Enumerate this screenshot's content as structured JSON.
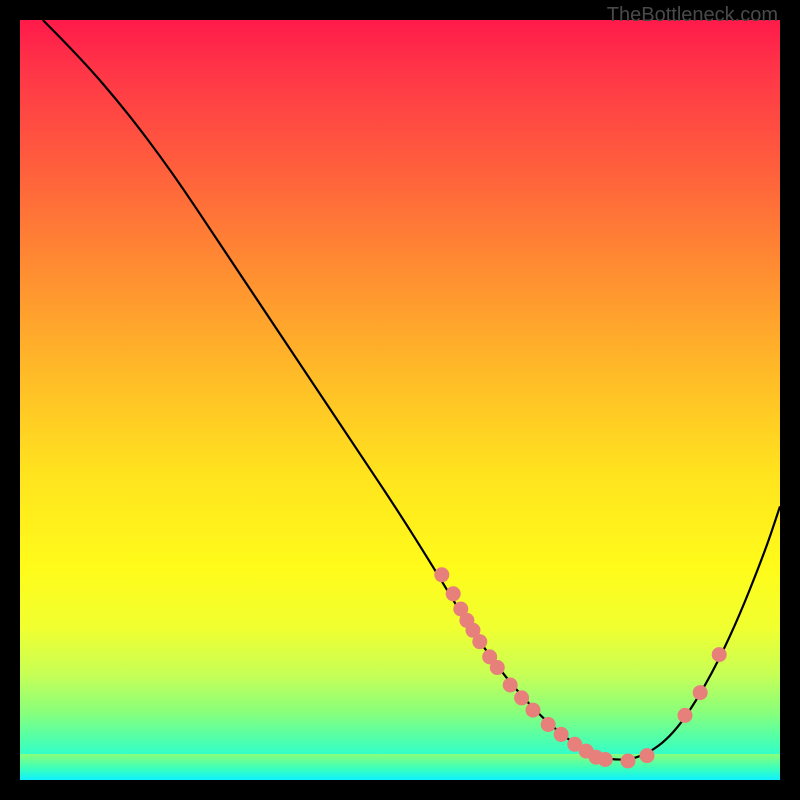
{
  "watermark": "TheBottleneck.com",
  "chart_data": {
    "type": "line",
    "title": "",
    "xlabel": "",
    "ylabel": "",
    "xlim": [
      0,
      100
    ],
    "ylim": [
      0,
      100
    ],
    "series": [
      {
        "name": "curve",
        "x": [
          3,
          8,
          14,
          20,
          26,
          32,
          38,
          44,
          50,
          55,
          58,
          62,
          66,
          70,
          74,
          78,
          82,
          86,
          90,
          94,
          98,
          100
        ],
        "y": [
          100,
          95,
          88,
          80,
          71,
          62,
          53,
          44,
          35,
          27,
          22,
          16,
          11,
          7,
          4,
          2.5,
          3,
          6,
          12,
          20,
          30,
          36
        ]
      }
    ],
    "markers": [
      {
        "x": 55.5,
        "y": 27.0
      },
      {
        "x": 57.0,
        "y": 24.5
      },
      {
        "x": 58.0,
        "y": 22.5
      },
      {
        "x": 58.8,
        "y": 21.0
      },
      {
        "x": 59.6,
        "y": 19.7
      },
      {
        "x": 60.5,
        "y": 18.2
      },
      {
        "x": 61.8,
        "y": 16.2
      },
      {
        "x": 62.8,
        "y": 14.8
      },
      {
        "x": 64.5,
        "y": 12.5
      },
      {
        "x": 66.0,
        "y": 10.8
      },
      {
        "x": 67.5,
        "y": 9.2
      },
      {
        "x": 69.5,
        "y": 7.3
      },
      {
        "x": 71.2,
        "y": 6.0
      },
      {
        "x": 73.0,
        "y": 4.7
      },
      {
        "x": 74.5,
        "y": 3.8
      },
      {
        "x": 75.8,
        "y": 3.0
      },
      {
        "x": 77.0,
        "y": 2.7
      },
      {
        "x": 80.0,
        "y": 2.5
      },
      {
        "x": 82.5,
        "y": 3.2
      },
      {
        "x": 87.5,
        "y": 8.5
      },
      {
        "x": 89.5,
        "y": 11.5
      },
      {
        "x": 92.0,
        "y": 16.5
      }
    ],
    "gradient_stops": [
      {
        "pos": 0,
        "color": "#ff1a4a"
      },
      {
        "pos": 18,
        "color": "#ff5a3e"
      },
      {
        "pos": 46,
        "color": "#ffb928"
      },
      {
        "pos": 72,
        "color": "#fffb1a"
      },
      {
        "pos": 91,
        "color": "#8aff7a"
      },
      {
        "pos": 100,
        "color": "#10ffff"
      }
    ]
  }
}
